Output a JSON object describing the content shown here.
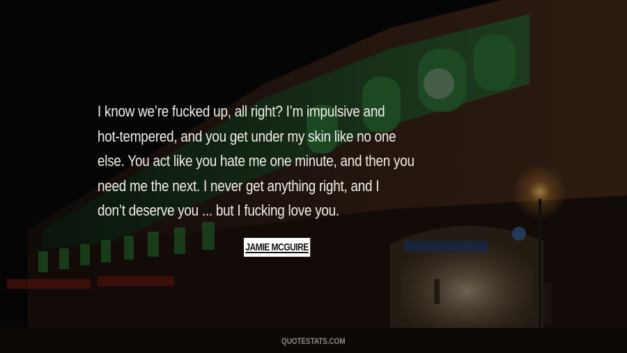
{
  "quote": {
    "lines": [
      "I know we’re fucked up, all right? I’m impulsive and",
      "hot-tempered, and you get under my skin like no one",
      "else. You act like you hate me one minute, and then you",
      "need me the next. I never get anything right, and I",
      "don’t deserve you ... but I fucking love you."
    ]
  },
  "author": "JAMIE MCGUIRE",
  "site": "QUOTESTATS.COM",
  "colors": {
    "background": "#0b0908",
    "quote_text": "#f2efe9",
    "facade_green": "#1f5a2a",
    "facade_brick": "#3a2418",
    "lamp_glow": "#f5b34a"
  }
}
